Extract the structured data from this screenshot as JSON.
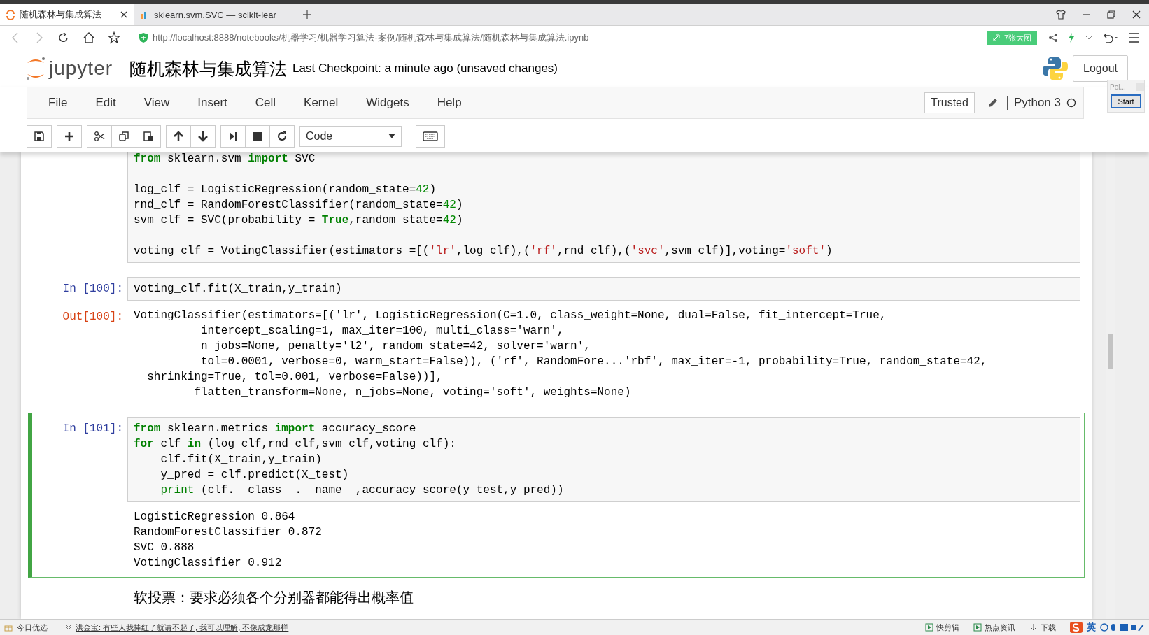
{
  "browser": {
    "tabs": [
      {
        "title": "随机森林与集成算法",
        "selected": true
      },
      {
        "title": "sklearn.svm.SVC — scikit-lear",
        "selected": false
      }
    ],
    "url": "http://localhost:8888/notebooks/机器学习/机器学习算法-案例/随机森林与集成算法/随机森林与集成算法.ipynb",
    "badge": "7张大图"
  },
  "header": {
    "logo_text": "jupyter",
    "notebook_title": "随机森林与集成算法",
    "checkpoint": "Last Checkpoint: a minute ago (unsaved changes)",
    "logout": "Logout"
  },
  "menu": [
    "File",
    "Edit",
    "View",
    "Insert",
    "Cell",
    "Kernel",
    "Widgets",
    "Help"
  ],
  "menu_right": {
    "trusted": "Trusted",
    "kernel": "Python 3"
  },
  "toolbar": {
    "cell_type": "Code"
  },
  "popup": {
    "title": "Poi...",
    "button": "Start"
  },
  "cells": [
    {
      "kind": "code",
      "selected": false,
      "source": [
        {
          "kind": "code",
          "tokens": [
            {
              "text": "from",
              "kind": "keyword"
            },
            {
              "text": " sklearn.svm ",
              "kind": "plain"
            },
            {
              "text": "import",
              "kind": "keyword"
            },
            {
              "text": " SVC",
              "kind": "plain"
            }
          ]
        },
        {
          "kind": "blank"
        },
        {
          "kind": "code",
          "tokens": [
            {
              "text": "log_clf = LogisticRegression(random_state=",
              "kind": "plain"
            },
            {
              "text": "42",
              "kind": "number"
            },
            {
              "text": ")",
              "kind": "plain"
            }
          ]
        },
        {
          "kind": "code",
          "tokens": [
            {
              "text": "rnd_clf = RandomForestClassifier(random_state=",
              "kind": "plain"
            },
            {
              "text": "42",
              "kind": "number"
            },
            {
              "text": ")",
              "kind": "plain"
            }
          ]
        },
        {
          "kind": "code",
          "tokens": [
            {
              "text": "svm_clf = SVC(probability = ",
              "kind": "plain"
            },
            {
              "text": "True",
              "kind": "keyword"
            },
            {
              "text": ",random_state=",
              "kind": "plain"
            },
            {
              "text": "42",
              "kind": "number"
            },
            {
              "text": ")",
              "kind": "plain"
            }
          ]
        },
        {
          "kind": "blank"
        },
        {
          "kind": "code",
          "tokens": [
            {
              "text": "voting_clf = VotingClassifier(estimators =[(",
              "kind": "plain"
            },
            {
              "text": "'lr'",
              "kind": "string"
            },
            {
              "text": ",log_clf),(",
              "kind": "plain"
            },
            {
              "text": "'rf'",
              "kind": "string"
            },
            {
              "text": ",rnd_clf),(",
              "kind": "plain"
            },
            {
              "text": "'svc'",
              "kind": "string"
            },
            {
              "text": ",svm_clf)],voting=",
              "kind": "plain"
            },
            {
              "text": "'soft'",
              "kind": "string"
            },
            {
              "text": ")",
              "kind": "plain"
            }
          ]
        }
      ]
    },
    {
      "kind": "code",
      "selected": false,
      "prompt": "In [100]:",
      "source": [
        {
          "kind": "code",
          "tokens": [
            {
              "text": "voting_clf.fit(X_train,y_train)",
              "kind": "plain"
            }
          ]
        }
      ],
      "output": {
        "prompt": "Out[100]:",
        "lines": [
          "VotingClassifier(estimators=[('lr', LogisticRegression(C=1.0, class_weight=None, dual=False, fit_intercept=True,",
          "          intercept_scaling=1, max_iter=100, multi_class='warn',",
          "          n_jobs=None, penalty='l2', random_state=42, solver='warn',",
          "          tol=0.0001, verbose=0, warm_start=False)), ('rf', RandomFore...'rbf', max_iter=-1, probability=True, random_state=42,",
          "  shrinking=True, tol=0.001, verbose=False))],",
          "         flatten_transform=None, n_jobs=None, voting='soft', weights=None)"
        ]
      }
    },
    {
      "kind": "code",
      "selected": true,
      "prompt": "In [101]:",
      "source": [
        {
          "kind": "code",
          "tokens": [
            {
              "text": "from",
              "kind": "keyword"
            },
            {
              "text": " sklearn.metrics ",
              "kind": "plain"
            },
            {
              "text": "import",
              "kind": "keyword"
            },
            {
              "text": " accuracy_score",
              "kind": "plain"
            }
          ]
        },
        {
          "kind": "code",
          "tokens": [
            {
              "text": "for",
              "kind": "keyword"
            },
            {
              "text": " clf ",
              "kind": "plain"
            },
            {
              "text": "in",
              "kind": "keyword"
            },
            {
              "text": " (log_clf,rnd_clf,svm_clf,voting_clf):",
              "kind": "plain"
            }
          ]
        },
        {
          "kind": "code",
          "tokens": [
            {
              "text": "    clf.fit(X_train,y_train)",
              "kind": "plain"
            }
          ]
        },
        {
          "kind": "code",
          "tokens": [
            {
              "text": "    y_pred = clf.predict(X_test)",
              "kind": "plain"
            }
          ]
        },
        {
          "kind": "indented",
          "tokens": [
            {
              "text": "print",
              "kind": "builtin"
            },
            {
              "text": " (clf.__class__.__name__,accuracy_score(y_test,y_pred))",
              "kind": "plain"
            }
          ]
        }
      ],
      "output": {
        "lines": [
          "LogisticRegression 0.864",
          "RandomForestClassifier 0.872",
          "SVC 0.888",
          "VotingClassifier 0.912"
        ]
      }
    },
    {
      "kind": "markdown",
      "selected": false,
      "text": "软投票：要求必须各个分别器都能得出概率值"
    }
  ],
  "status_bar": {
    "left": "今日优选",
    "news": "洪金宝: 有些人我捧红了就请不起了, 我可以理解, 不像成龙那样",
    "right": [
      "快剪辑",
      "热点资讯",
      "下载"
    ],
    "ime": "英"
  }
}
